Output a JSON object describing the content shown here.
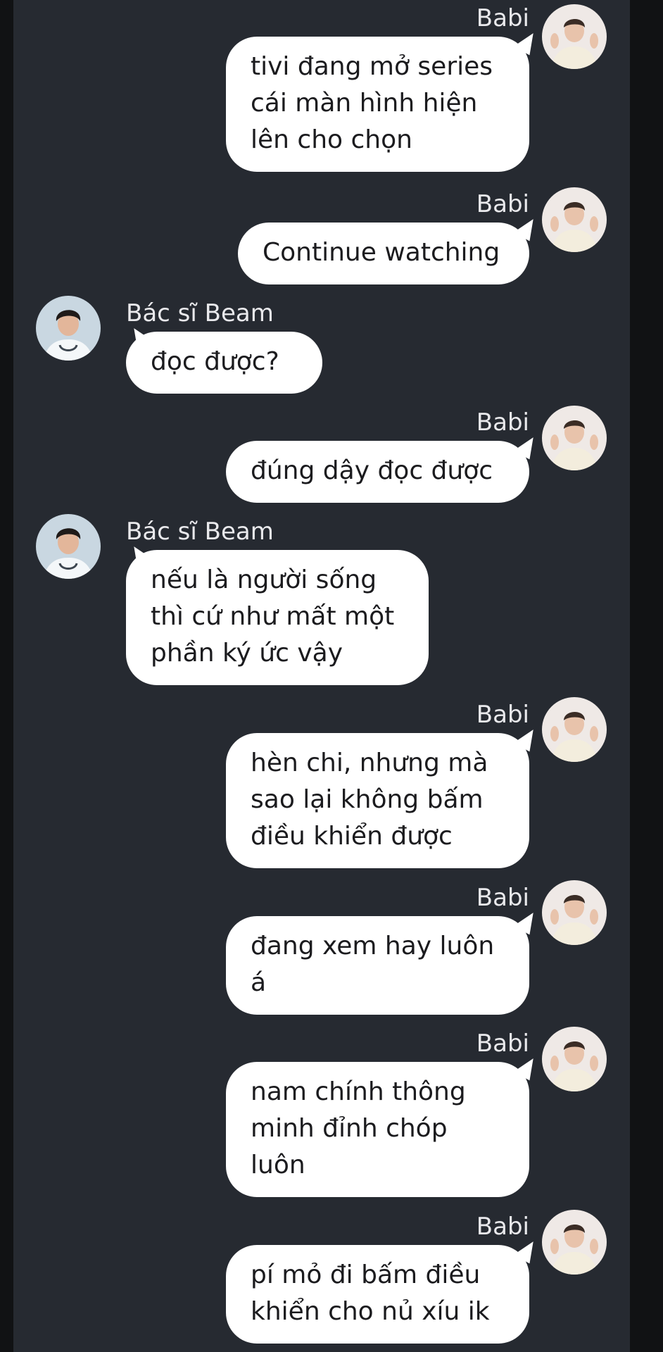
{
  "messages": [
    {
      "sender": "Babi",
      "side": "out",
      "lines": [
        "tivi đang mở series",
        "cái màn hình hiện",
        "lên cho chọn"
      ]
    },
    {
      "sender": "Babi",
      "side": "out",
      "lines": [
        "Continue watching"
      ]
    },
    {
      "sender": "Bác sĩ Beam",
      "side": "in",
      "lines": [
        "đọc được?"
      ]
    },
    {
      "sender": "Babi",
      "side": "out",
      "lines": [
        "đúng dậy đọc được"
      ]
    },
    {
      "sender": "Bác sĩ Beam",
      "side": "in",
      "lines": [
        "nếu là người sống",
        "thì cứ như mất một",
        "phần ký ức vậy"
      ]
    },
    {
      "sender": "Babi",
      "side": "out",
      "lines": [
        "hèn chi, nhưng mà",
        "sao lại không bấm",
        "điều khiển được"
      ]
    },
    {
      "sender": "Babi",
      "side": "out",
      "lines": [
        "đang xem hay luôn",
        "á"
      ]
    },
    {
      "sender": "Babi",
      "side": "out",
      "lines": [
        "nam chính thông",
        "minh đỉnh chóp",
        "luôn"
      ]
    },
    {
      "sender": "Babi",
      "side": "out",
      "lines": [
        "pí mỏ đi bấm điều",
        "khiển cho nủ xíu ik"
      ]
    }
  ],
  "avatars": {
    "out": "babi-avatar",
    "in": "doctor-beam-avatar"
  },
  "colors": {
    "page_bg": "#111214",
    "chat_bg": "#262a31",
    "bubble": "#ffffff",
    "sender_text": "#e9e9ec",
    "message_text": "#1b1b1e"
  }
}
